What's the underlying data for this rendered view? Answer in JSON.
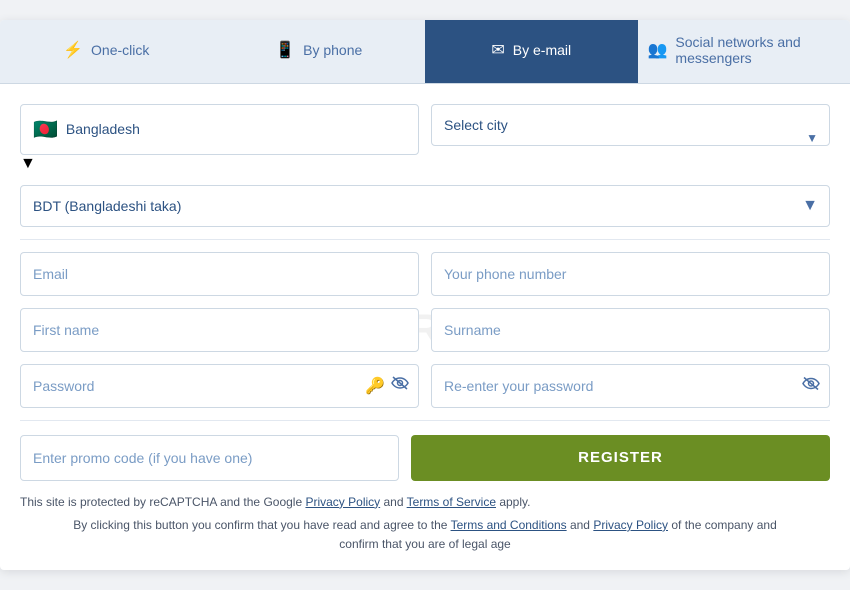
{
  "tabs": [
    {
      "id": "one-click",
      "label": "One-click",
      "icon": "⚡",
      "active": false
    },
    {
      "id": "by-phone",
      "label": "By phone",
      "icon": "📱",
      "active": false
    },
    {
      "id": "by-email",
      "label": "By e-mail",
      "icon": "✉",
      "active": true
    },
    {
      "id": "social",
      "label": "Social networks and messengers",
      "icon": "👥",
      "active": false
    }
  ],
  "country": {
    "flag": "🇧🇩",
    "name": "Bangladesh",
    "placeholder": "Select city"
  },
  "currency": {
    "value": "BDT (Bangladeshi taka)"
  },
  "fields": {
    "email": {
      "placeholder": "Email"
    },
    "phone": {
      "placeholder": "Your phone number"
    },
    "firstname": {
      "placeholder": "First name"
    },
    "surname": {
      "placeholder": "Surname"
    },
    "password": {
      "placeholder": "Password"
    },
    "reenter_password": {
      "placeholder": "Re-enter your password"
    },
    "promo": {
      "placeholder": "Enter promo code (if you have one)"
    }
  },
  "buttons": {
    "register": "REGISTER"
  },
  "legal": {
    "line1_before": "This site is protected by reCAPTCHA and the Google ",
    "privacy_policy": "Privacy Policy",
    "and": " and ",
    "terms_of_service": "Terms of Service",
    "line1_after": " apply.",
    "line2_before": "By clicking this button you confirm that you have read and agree to the ",
    "terms_conditions": "Terms and Conditions",
    "and2": " and ",
    "privacy_policy2": "Privacy Policy",
    "line2_after": " of the company and",
    "line3": "confirm that you are of legal age"
  },
  "watermark": "N⊙STRABET"
}
